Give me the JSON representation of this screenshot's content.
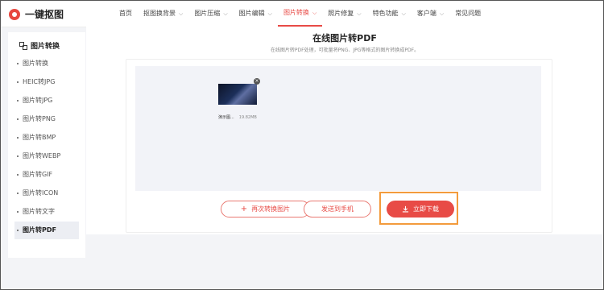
{
  "logo": {
    "text": "一键抠图"
  },
  "nav": [
    {
      "label": "首页",
      "has_dropdown": false,
      "active": false
    },
    {
      "label": "抠图换背景",
      "has_dropdown": true,
      "active": false
    },
    {
      "label": "图片压缩",
      "has_dropdown": true,
      "active": false
    },
    {
      "label": "图片编辑",
      "has_dropdown": true,
      "active": false
    },
    {
      "label": "图片转换",
      "has_dropdown": true,
      "active": true
    },
    {
      "label": "照片修复",
      "has_dropdown": true,
      "active": false
    },
    {
      "label": "特色功能",
      "has_dropdown": true,
      "active": false
    },
    {
      "label": "客户端",
      "has_dropdown": true,
      "active": false
    },
    {
      "label": "常见问题",
      "has_dropdown": false,
      "active": false
    }
  ],
  "sidebar": {
    "title": "图片转换",
    "items": [
      {
        "label": "图片转换",
        "active": false
      },
      {
        "label": "HEIC转JPG",
        "active": false
      },
      {
        "label": "图片转JPG",
        "active": false
      },
      {
        "label": "图片转PNG",
        "active": false
      },
      {
        "label": "图片转BMP",
        "active": false
      },
      {
        "label": "图片转WEBP",
        "active": false
      },
      {
        "label": "图片转GIF",
        "active": false
      },
      {
        "label": "图片转ICON",
        "active": false
      },
      {
        "label": "图片转文字",
        "active": false
      },
      {
        "label": "图片转PDF",
        "active": true
      }
    ]
  },
  "main": {
    "title": "在线图片转PDF",
    "subtitle": "在线图片转PDF处理，可批量将PNG、JPG等格式的图片转换成PDF。"
  },
  "file": {
    "name": "演示图...",
    "size": "19.82MB"
  },
  "buttons": {
    "convert_again": "再次转换图片",
    "send_to_phone": "发送到手机",
    "download": "立即下载"
  },
  "colors": {
    "accent": "#e84b46",
    "highlight": "#f39b3c"
  }
}
